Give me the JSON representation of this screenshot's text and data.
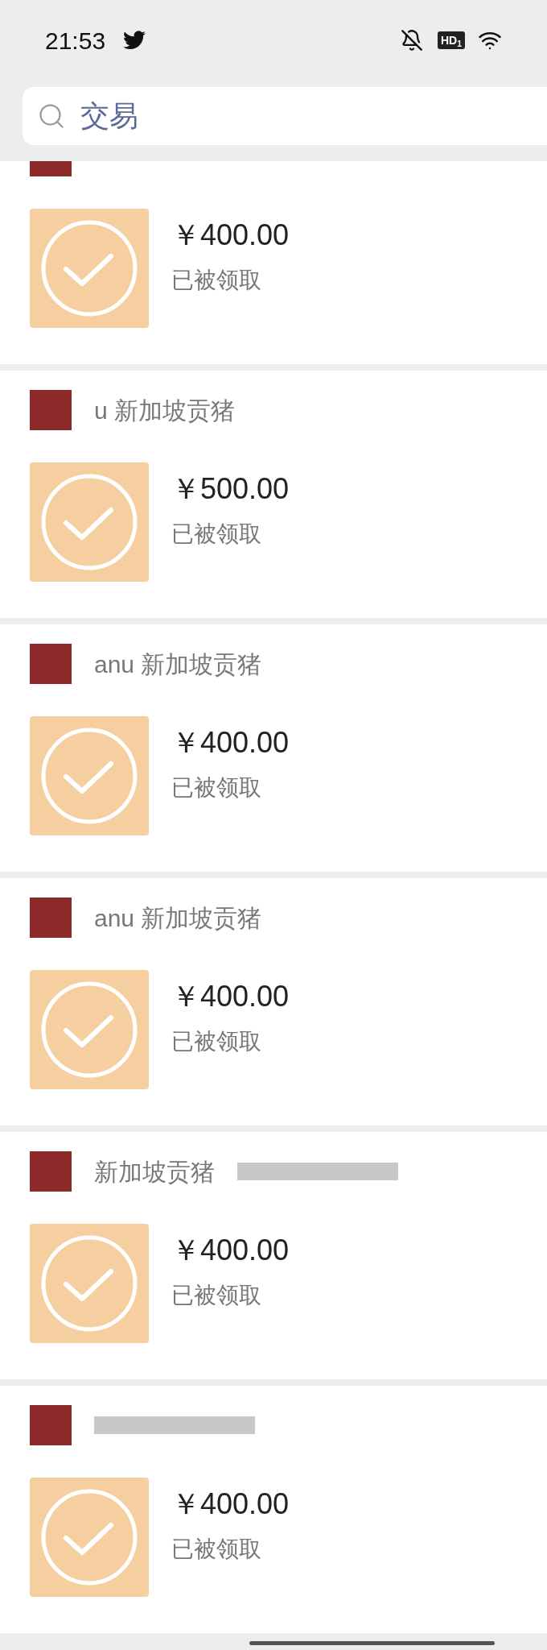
{
  "status_bar": {
    "time": "21:53",
    "badge": "HD$_{1}$"
  },
  "search": {
    "value": "交易"
  },
  "cards": [
    {
      "cut": true,
      "redacted": false,
      "amount": "￥400.00",
      "status": "已被领取"
    },
    {
      "cut": false,
      "sender": "u 新加坡贡猪",
      "redacted": false,
      "amount": "￥500.00",
      "status": "已被领取"
    },
    {
      "cut": false,
      "sender": "anu 新加坡贡猪",
      "redacted": false,
      "amount": "￥400.00",
      "status": "已被领取"
    },
    {
      "cut": false,
      "sender": "anu 新加坡贡猪",
      "redacted": false,
      "amount": "￥400.00",
      "status": "已被领取"
    },
    {
      "cut": false,
      "sender": "新加坡贡猪",
      "redacted": true,
      "amount": "￥400.00",
      "status": "已被领取"
    },
    {
      "cut": false,
      "redacted": true,
      "amount": "￥400.00",
      "status": "已被领取"
    }
  ]
}
